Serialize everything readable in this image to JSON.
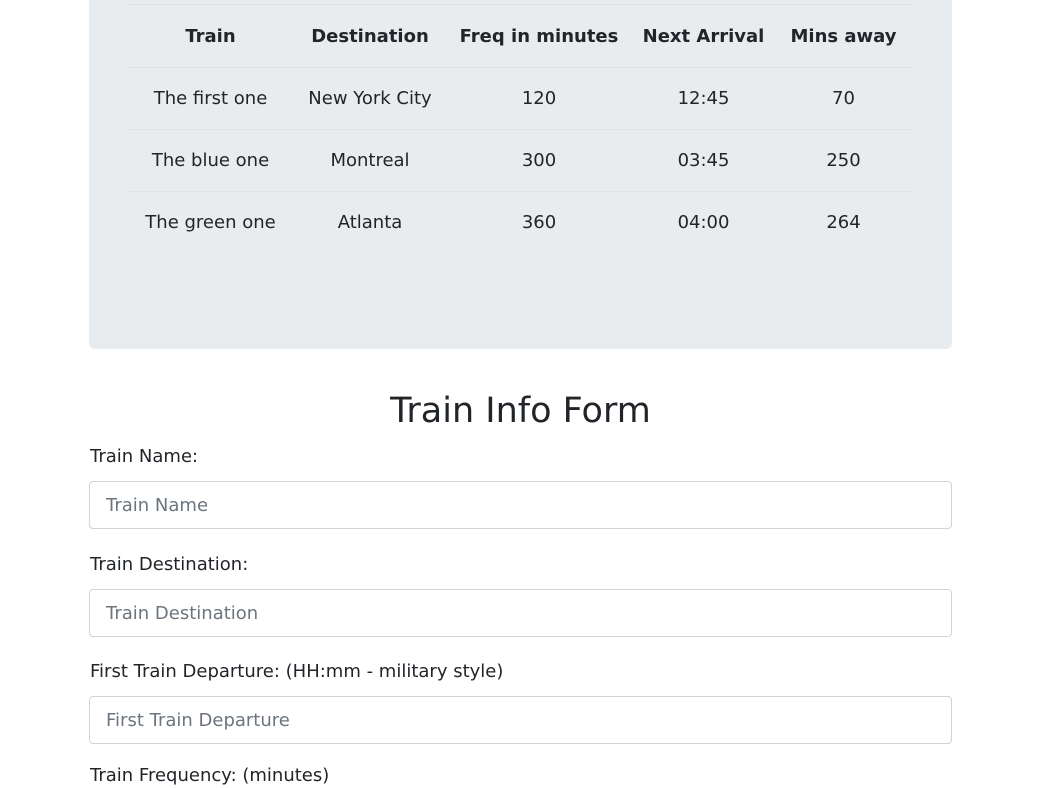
{
  "schedule": {
    "headers": [
      "Train",
      "Destination",
      "Freq in minutes",
      "Next Arrival",
      "Mins away"
    ],
    "rows": [
      {
        "train": "The first one",
        "destination": "New York City",
        "frequency": "120",
        "next_arrival": "12:45",
        "mins_away": "70"
      },
      {
        "train": "The blue one",
        "destination": "Montreal",
        "frequency": "300",
        "next_arrival": "03:45",
        "mins_away": "250"
      },
      {
        "train": "The green one",
        "destination": "Atlanta",
        "frequency": "360",
        "next_arrival": "04:00",
        "mins_away": "264"
      }
    ]
  },
  "form": {
    "title": "Train Info Form",
    "fields": [
      {
        "label": "Train Name:",
        "placeholder": "Train Name",
        "value": ""
      },
      {
        "label": "Train Destination:",
        "placeholder": "Train Destination",
        "value": ""
      },
      {
        "label": "First Train Departure: (HH:mm - military style)",
        "placeholder": "First Train Departure",
        "value": ""
      },
      {
        "label": "Train Frequency: (minutes)"
      }
    ]
  },
  "colors": {
    "panel_background": "#e9ecef",
    "border": "#dee2e6",
    "input_border": "#ced4da",
    "text": "#212529",
    "placeholder": "#6c757d"
  }
}
